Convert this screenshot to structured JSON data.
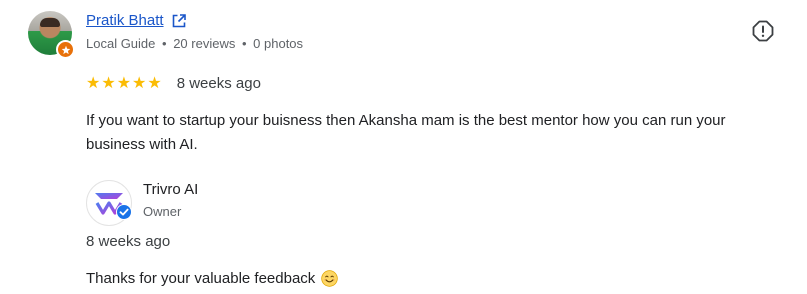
{
  "reviewer": {
    "name": "Pratik Bhatt",
    "role": "Local Guide",
    "reviews": "20 reviews",
    "photos": "0 photos",
    "separator": "•"
  },
  "review": {
    "rating": 5,
    "stars": "★★★★★",
    "time": "8 weeks ago",
    "text": "If you want to startup your buisness then Akansha mam is the best mentor how you can run your business with AI."
  },
  "owner_response": {
    "name": "Trivro AI",
    "role": "Owner",
    "time": "8 weeks ago",
    "text": "Thanks for your valuable feedback"
  },
  "icons": {
    "external_link": "external-link-icon",
    "report": "report-icon",
    "local_guide_badge": "local-guide-badge-icon",
    "verified": "verified-check-icon",
    "emoji": "smiling-face-emoji"
  },
  "colors": {
    "link": "#1a56c9",
    "star": "#fbbc04",
    "guide_badge": "#e8710a",
    "verified": "#1a73e8",
    "muted": "#5f6368"
  }
}
